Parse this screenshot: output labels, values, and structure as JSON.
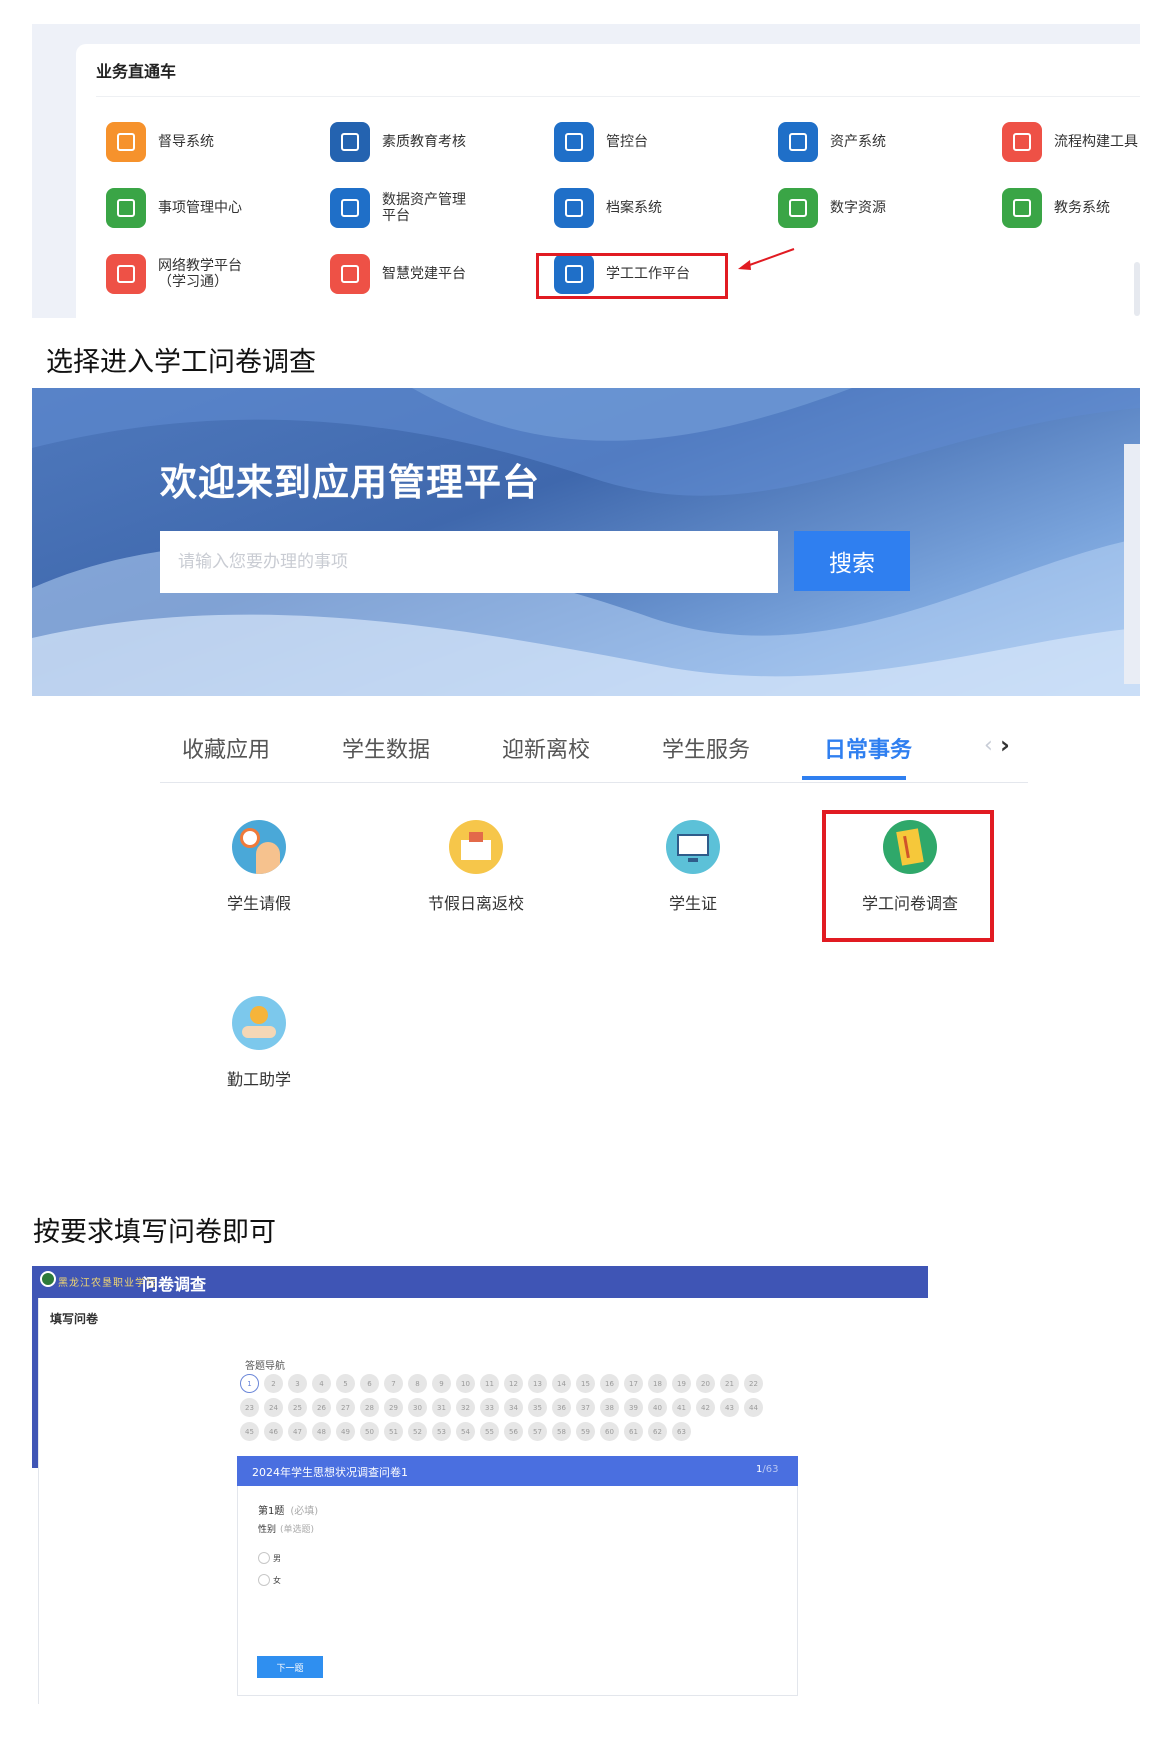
{
  "section1": {
    "title": "业务直通车",
    "apps": [
      {
        "label": "督导系统",
        "icon": "flask-badge-icon",
        "color": "#f6922c"
      },
      {
        "label": "素质教育考核",
        "icon": "chart-board-icon",
        "color": "#2463b0"
      },
      {
        "label": "管控台",
        "icon": "desk-person-icon",
        "color": "#1f6fc8"
      },
      {
        "label": "资产系统",
        "icon": "flask-coin-icon",
        "color": "#1f6fc8"
      },
      {
        "label": "流程构建工具",
        "icon": "cycle-arrows-icon",
        "color": "#ee5146"
      },
      {
        "label": "事项管理中心",
        "icon": "share-arrow-icon",
        "color": "#3aa546"
      },
      {
        "label": "数据资产管理\n平台",
        "icon": "flask-coin-icon",
        "color": "#1f6fc8"
      },
      {
        "label": "档案系统",
        "icon": "archive-icon",
        "color": "#1f6fc8"
      },
      {
        "label": "数字资源",
        "icon": "cloud-download-icon",
        "color": "#3aa546"
      },
      {
        "label": "教务系统",
        "icon": "bar-chart-icon",
        "color": "#3aa546"
      },
      {
        "label": "网络教学平台\n（学习通）",
        "icon": "abc-icon",
        "color": "#ee5146"
      },
      {
        "label": "智慧党建平台",
        "icon": "presentation-icon",
        "color": "#ee5146"
      },
      {
        "label": "学工工作平台",
        "icon": "teacher-board-icon",
        "color": "#1f6fc8"
      }
    ]
  },
  "caption1": "选择进入学工问卷调查",
  "banner": {
    "title": "欢迎来到应用管理平台",
    "search_placeholder": "请输入您要办理的事项",
    "search_button": "搜索"
  },
  "tabs": [
    {
      "label": "收藏应用"
    },
    {
      "label": "学生数据"
    },
    {
      "label": "迎新离校"
    },
    {
      "label": "学生服务"
    },
    {
      "label": "日常事务"
    }
  ],
  "services": [
    {
      "label": "学生请假",
      "icon": "clock-student-icon"
    },
    {
      "label": "节假日离返校",
      "icon": "school-building-icon"
    },
    {
      "label": "学生证",
      "icon": "computer-screen-icon"
    },
    {
      "label": "学工问卷调查",
      "icon": "questionnaire-book-icon"
    },
    {
      "label": "勤工助学",
      "icon": "hand-coin-icon"
    }
  ],
  "caption2": "按要求填写问卷即可",
  "questionnaire": {
    "school_name": "黑龙江农垦职业学院",
    "header": "问卷调查",
    "fill_label": "填写问卷",
    "nav_label": "答题导航",
    "total_questions": 63,
    "current_question": 1,
    "survey_title": "2024年学生思想状况调查问卷1",
    "page_current": "1",
    "page_total": "/63",
    "question_no": "第1题",
    "required": "(必填)",
    "question_text": "性别",
    "question_type": "(单选题)",
    "options": [
      "男",
      "女"
    ],
    "next_button": "下一题"
  }
}
